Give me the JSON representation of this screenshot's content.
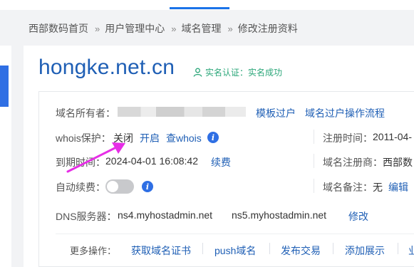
{
  "breadcrumb": {
    "items": [
      "西部数码首页",
      "用户管理中心",
      "域名管理",
      "修改注册资料"
    ],
    "separator": "»"
  },
  "domain": {
    "name": "hongke.net.cn",
    "realname_label": "实名认证：",
    "realname_status": "实名成功"
  },
  "owner": {
    "label": "域名所有者：",
    "template_transfer": "模板过户",
    "transfer_flow": "域名过户操作流程"
  },
  "whois": {
    "label": "whois保护：",
    "status": "关闭",
    "enable": "开启",
    "lookup": "查whois",
    "info_icon": "i"
  },
  "expiry": {
    "label": "到期时间：",
    "value": "2024-04-01 16:08:42",
    "renew": "续费"
  },
  "auto_renew": {
    "label": "自动续费：",
    "enabled": false,
    "info_icon": "i"
  },
  "reg_time": {
    "label": "注册时间：",
    "value": "2011-04-"
  },
  "registrar": {
    "label": "域名注册商：",
    "value": "西部数"
  },
  "remark": {
    "label": "域名备注：",
    "value": "无",
    "edit": "编辑"
  },
  "dns": {
    "label": "DNS服务器：",
    "ns1": "ns4.myhostadmin.net",
    "ns2": "ns5.myhostadmin.net",
    "modify": "修改"
  },
  "more_ops": {
    "label": "更多操作：",
    "items": [
      "获取域名证书",
      "push域名",
      "发布交易",
      "添加展示",
      "业"
    ]
  },
  "colors": {
    "link": "#1f5fb5",
    "success": "#2ca77a",
    "accent": "#2f6fe4",
    "arrow": "#e62ee6"
  }
}
